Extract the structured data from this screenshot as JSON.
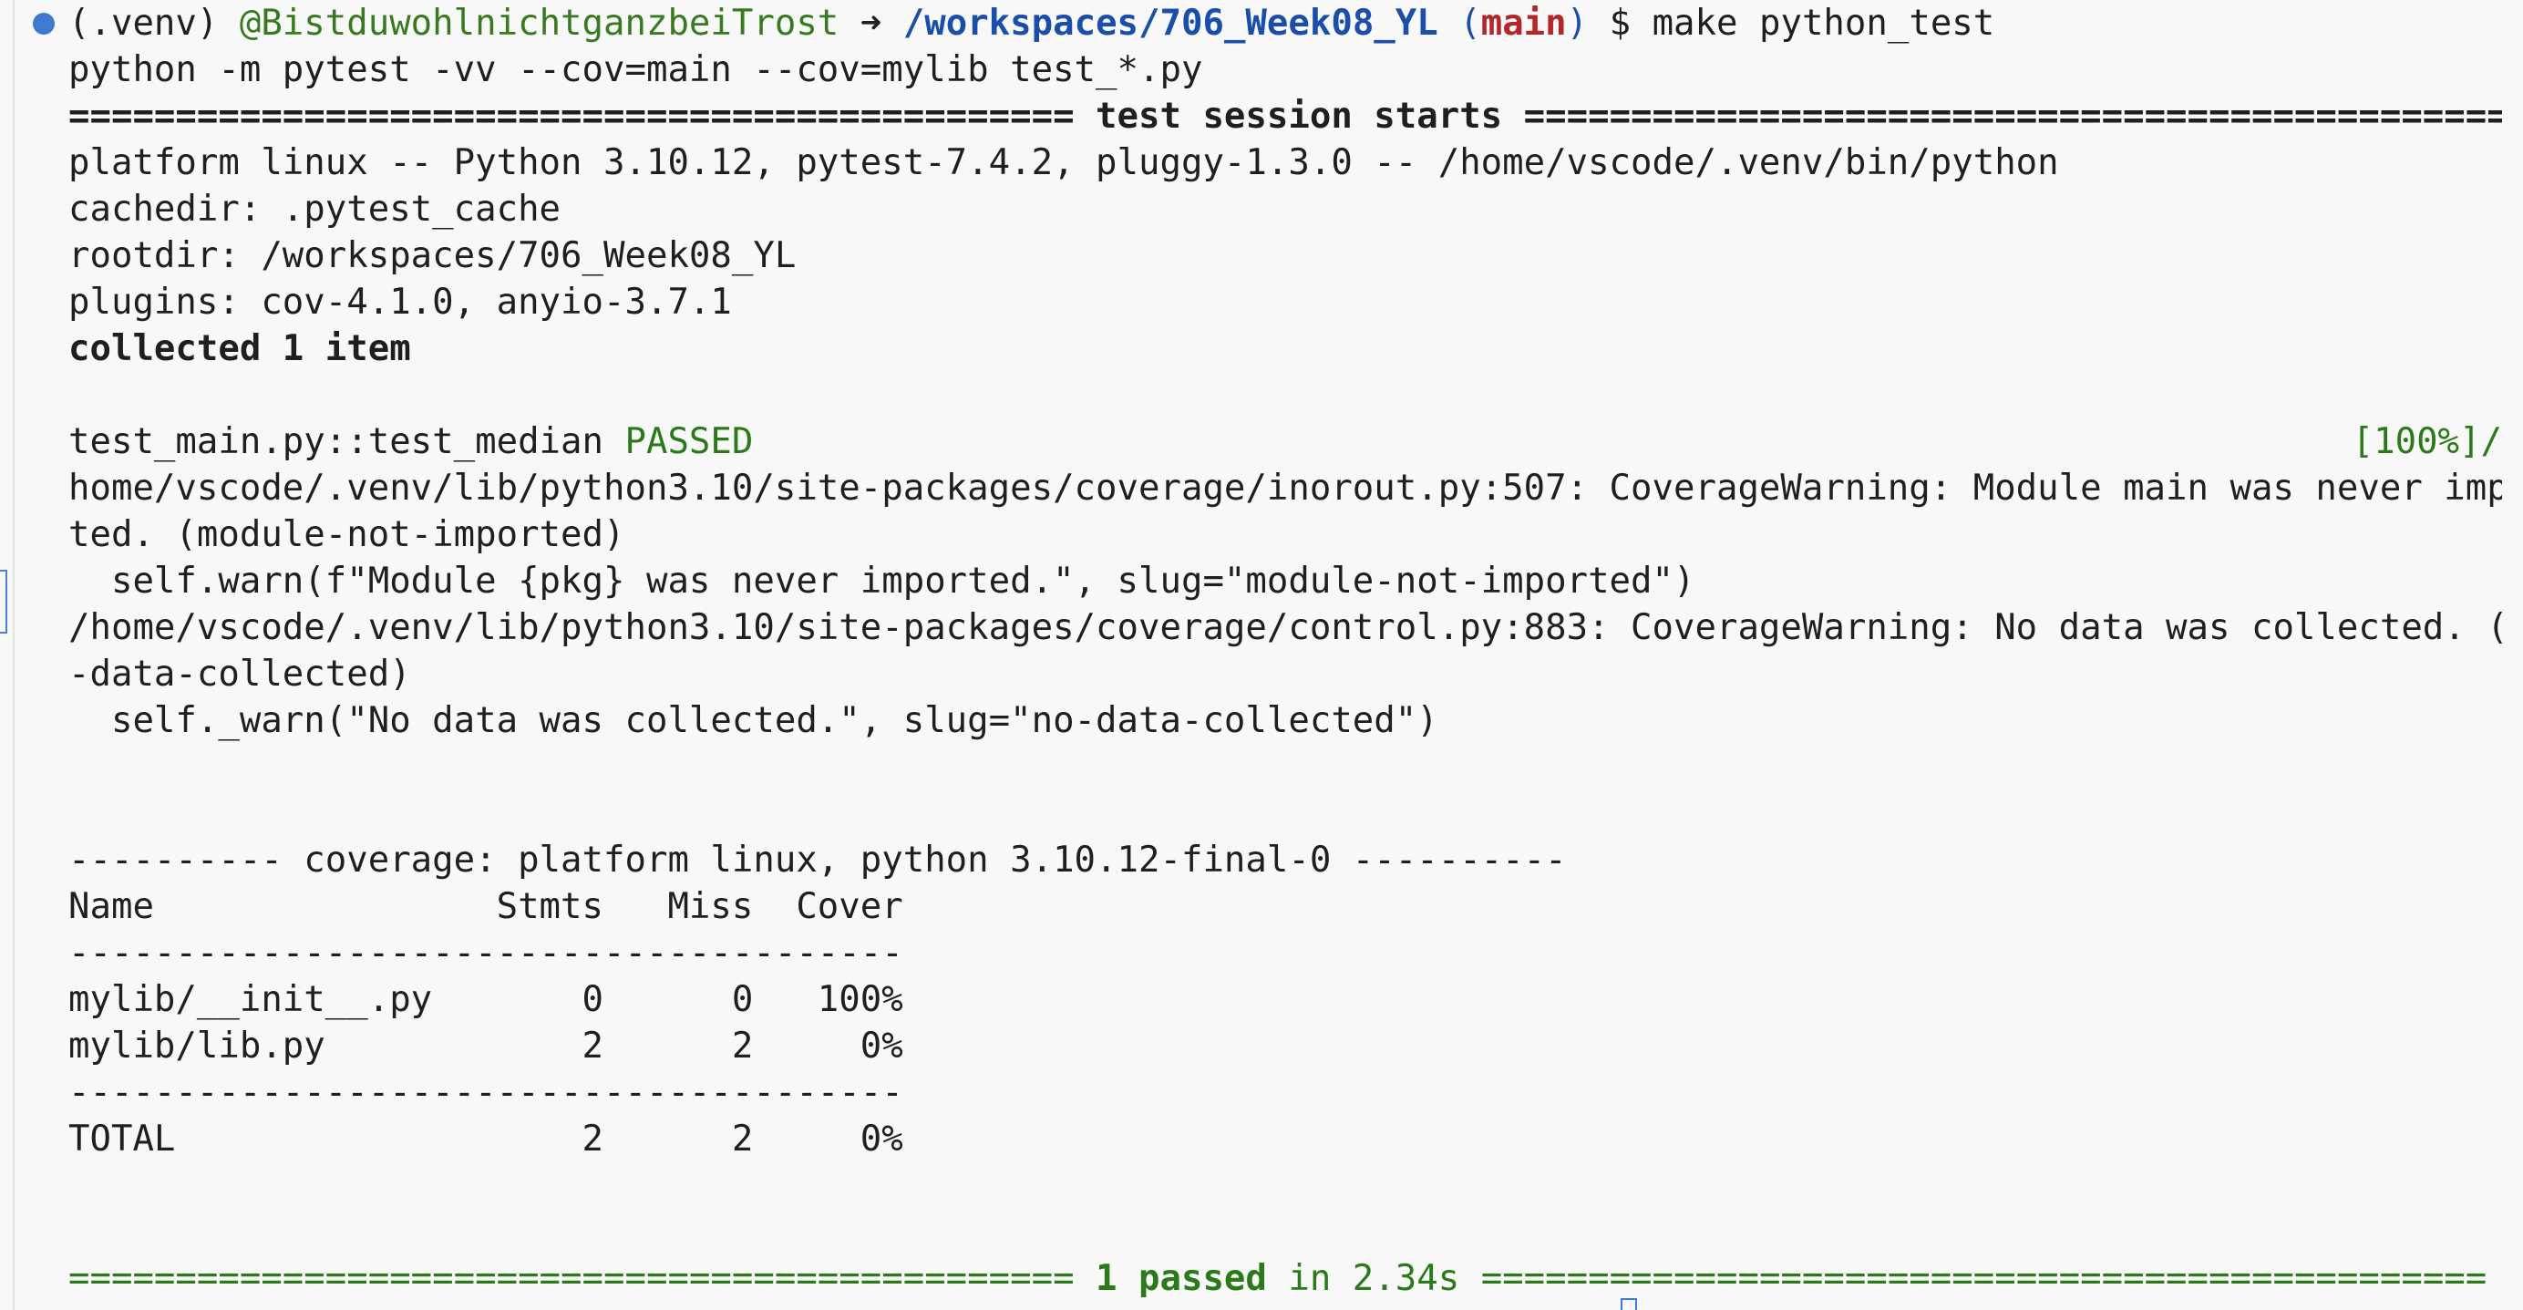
{
  "prompt": {
    "venv": "(.venv) ",
    "user": "@BistduwohlnichtganzbeiTrost",
    "arrow": " ➜ ",
    "path": "/workspaces/706_Week08_YL",
    "branch_open": " (",
    "branch": "main",
    "branch_close": ")",
    "dollar": " $ ",
    "command": "make python_test"
  },
  "output": {
    "cmd_echo": "python -m pytest -vv --cov=main --cov=mylib test_*.py",
    "session_left": "=============================================== ",
    "session_title": "test session starts",
    "session_right": " ===============================================",
    "platform": "platform linux -- Python 3.10.12, pytest-7.4.2, pluggy-1.3.0 -- /home/vscode/.venv/bin/python",
    "cachedir": "cachedir: .pytest_cache",
    "rootdir": "rootdir: /workspaces/706_Week08_YL",
    "plugins": "plugins: cov-4.1.0, anyio-3.7.1",
    "collected": "collected 1 item",
    "test_name": "test_main.py::test_median ",
    "test_status": "PASSED",
    "test_percent": "[100%]/",
    "warn1_line1": "home/vscode/.venv/lib/python3.10/site-packages/coverage/inorout.py:507: CoverageWarning: Module main was never impor",
    "warn1_line2": "ted. (module-not-imported)",
    "warn1_code": "  self.warn(f\"Module {pkg} was never imported.\", slug=\"module-not-imported\")",
    "warn2_line1": "/home/vscode/.venv/lib/python3.10/site-packages/coverage/control.py:883: CoverageWarning: No data was collected. (no",
    "warn2_line2": "-data-collected)",
    "warn2_code": "  self._warn(\"No data was collected.\", slug=\"no-data-collected\")",
    "coverage_header": "---------- coverage: platform linux, python 3.10.12-final-0 ----------",
    "summary_left": "=============================================== ",
    "summary_passed": "1 passed",
    "summary_time": " in 2.34s",
    "summary_right": " ==============================================="
  },
  "coverage_table": {
    "header": "Name                Stmts   Miss  Cover",
    "separator": "---------------------------------------",
    "rows": [
      "mylib/__init__.py       0      0   100%",
      "mylib/lib.py            2      2     0%"
    ],
    "total": "TOTAL                   2      2     0%"
  },
  "colors": {
    "background": "#f8f8f8",
    "text": "#1f1f1f",
    "user": "#387a1f",
    "path": "#1a4ea8",
    "branch": "#b3262a",
    "passed": "#2a7a19",
    "status_dot": "#3e7bd0"
  }
}
